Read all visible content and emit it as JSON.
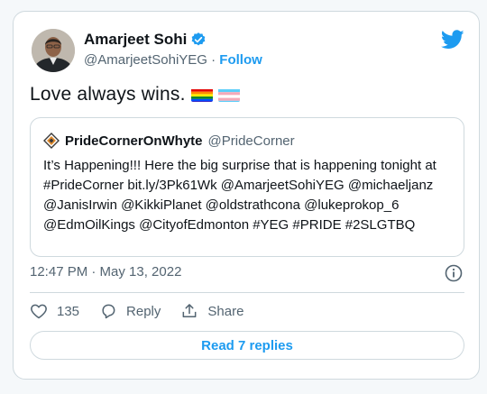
{
  "author": {
    "name": "Amarjeet Sohi",
    "handle": "@AmarjeetSohiYEG",
    "separator": "·",
    "follow_label": "Follow"
  },
  "tweet": {
    "text": "Love always wins.",
    "emoji": [
      "rainbow-flag",
      "transgender-flag"
    ]
  },
  "quoted_tweet": {
    "name": "PrideCornerOnWhyte",
    "handle": "@PrideCorner",
    "text": "It’s Happening!!! Here the big surprise that is happening tonight at #PrideCorner bit.ly/3Pk61Wk @AmarjeetSohiYEG @michaeljanz @JanisIrwin @KikkiPlanet @oldstrathcona @lukeprokop_6 @EdmOilKings @CityofEdmonton #YEG #PRIDE #2SLGTBQ"
  },
  "meta": {
    "timestamp": "12:47 PM · May 13, 2022"
  },
  "actions": {
    "like_count": "135",
    "reply_label": "Reply",
    "share_label": "Share"
  },
  "read_replies_label": "Read 7 replies",
  "colors": {
    "accent": "#1d9bf0",
    "text": "#0f1419",
    "secondary": "#536471",
    "border": "#cfd9de"
  },
  "icons": [
    "verified-icon",
    "twitter-bird-icon",
    "info-icon",
    "heart-icon",
    "reply-icon",
    "share-icon"
  ]
}
